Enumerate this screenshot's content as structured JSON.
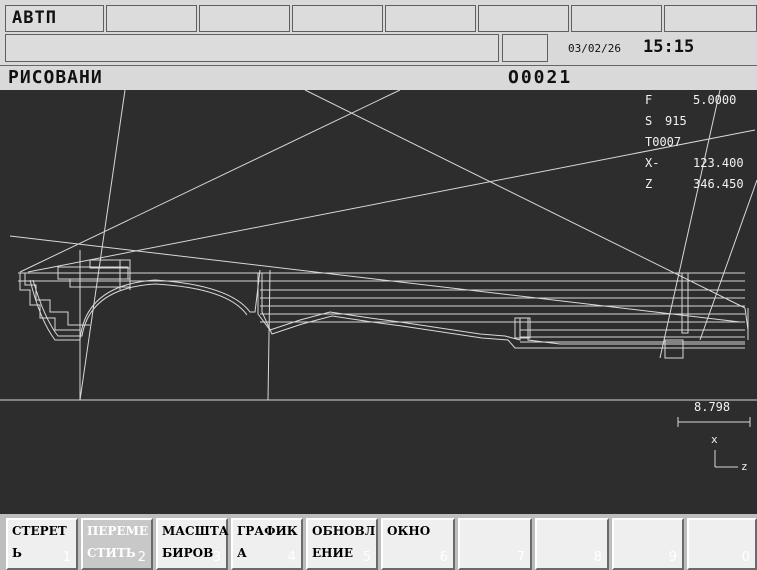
{
  "status": {
    "mode": "АВТП",
    "date": "03/02/26",
    "time": "15:15"
  },
  "screen": {
    "title": "РИСОВАНИ",
    "program_number": "O0021"
  },
  "readout": {
    "f_label": "F",
    "f_value": "5.0000",
    "s_label": "S",
    "s_value": "915",
    "t_value": "T0007",
    "x_label": "X-",
    "x_value": "123.400",
    "z_label": "Z",
    "z_value": "346.450"
  },
  "scale": {
    "value": "8.798"
  },
  "axes": {
    "x_label": "x",
    "z_label": "z"
  },
  "colors": {
    "canvas_bg": "#2d2d2d",
    "drawing_line": "#e6e6e6"
  },
  "softkeys": [
    {
      "line1": "СТЕРЕТ",
      "line2": "Ь",
      "number": "1"
    },
    {
      "line1": "ПЕРЕМЕ",
      "line2": "СТИТЬ",
      "number": "2",
      "active": true
    },
    {
      "line1": "МАСШТА",
      "line2": "БИРОВ",
      "number": "3"
    },
    {
      "line1": "ГРАФИК",
      "line2": "А",
      "number": "4"
    },
    {
      "line1": "ОБНОВЛ",
      "line2": "ЕНИЕ",
      "number": "5"
    },
    {
      "line1": "ОКНО",
      "line2": "",
      "number": "6"
    },
    {
      "line1": "",
      "line2": "",
      "number": "7"
    },
    {
      "line1": "",
      "line2": "",
      "number": "8"
    },
    {
      "line1": "",
      "line2": "",
      "number": "9"
    },
    {
      "line1": "",
      "line2": "",
      "number": "0"
    }
  ]
}
